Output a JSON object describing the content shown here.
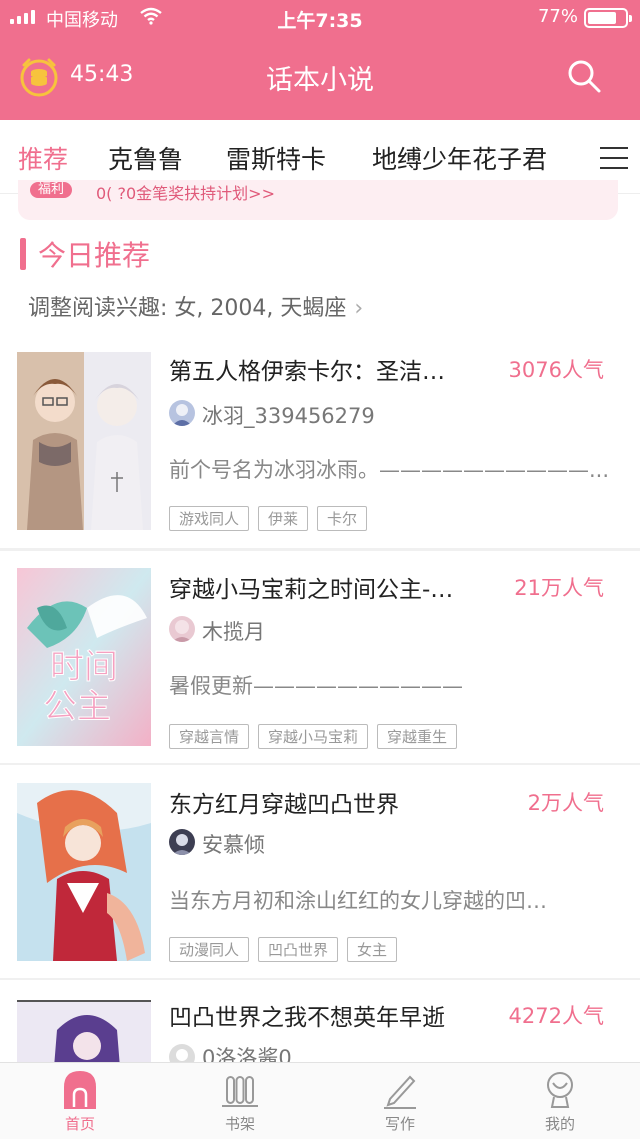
{
  "status_bar": {
    "carrier": "中国移动",
    "time": "上午7:35",
    "battery": "77%",
    "battery_level": 0.77
  },
  "header": {
    "timer": "45:43",
    "title": "话本小说"
  },
  "tabs": [
    {
      "label": "推荐",
      "active": true
    },
    {
      "label": "克鲁鲁",
      "active": false
    },
    {
      "label": "雷斯特卡",
      "active": false
    },
    {
      "label": "地缚少年花子君",
      "active": false
    }
  ],
  "banner": {
    "pill": "福利",
    "text": "0(        ?0金笔奖扶持计划>>"
  },
  "section": {
    "title": "今日推荐",
    "interest": "调整阅读兴趣: 女, 2004, 天蝎座"
  },
  "books": [
    {
      "title": "第五人格伊索卡尔：圣洁…",
      "popularity": "3076人气",
      "author": "冰羽_339456279",
      "desc": "前个号名为冰羽冰雨。——————————...",
      "tags": [
        "游戏同人",
        "伊莱",
        "卡尔"
      ],
      "cover_colors": [
        "#d9c3b0",
        "#e9e6ee"
      ]
    },
    {
      "title": "穿越小马宝莉之时间公主-…",
      "popularity": "21万人气",
      "author": "木揽月",
      "desc": "暑假更新——————————",
      "tags": [
        "穿越言情",
        "穿越小马宝莉",
        "穿越重生"
      ],
      "cover_colors": [
        "#f3b6cc",
        "#b9e0e6"
      ]
    },
    {
      "title": "东方红月穿越凹凸世界",
      "popularity": "2万人气",
      "author": "安慕倾",
      "desc": "当东方月初和涂山红红的女儿穿越的凹…",
      "tags": [
        "动漫同人",
        "凹凸世界",
        "女主"
      ],
      "cover_colors": [
        "#e05a4a",
        "#b8d9ea"
      ]
    },
    {
      "title": "凹凸世界之我不想英年早逝",
      "popularity": "4272人气",
      "author": "0洛洛酱0",
      "desc": "",
      "tags": [],
      "cover_colors": [
        "#e8e4f2",
        "#7a5fb0"
      ]
    }
  ],
  "bottom_nav": [
    {
      "label": "首页",
      "icon": "home-icon",
      "active": true
    },
    {
      "label": "书架",
      "icon": "bookshelf-icon",
      "active": false
    },
    {
      "label": "写作",
      "icon": "pen-icon",
      "active": false
    },
    {
      "label": "我的",
      "icon": "profile-icon",
      "active": false
    }
  ],
  "colors": {
    "accent": "#f06f8e"
  }
}
